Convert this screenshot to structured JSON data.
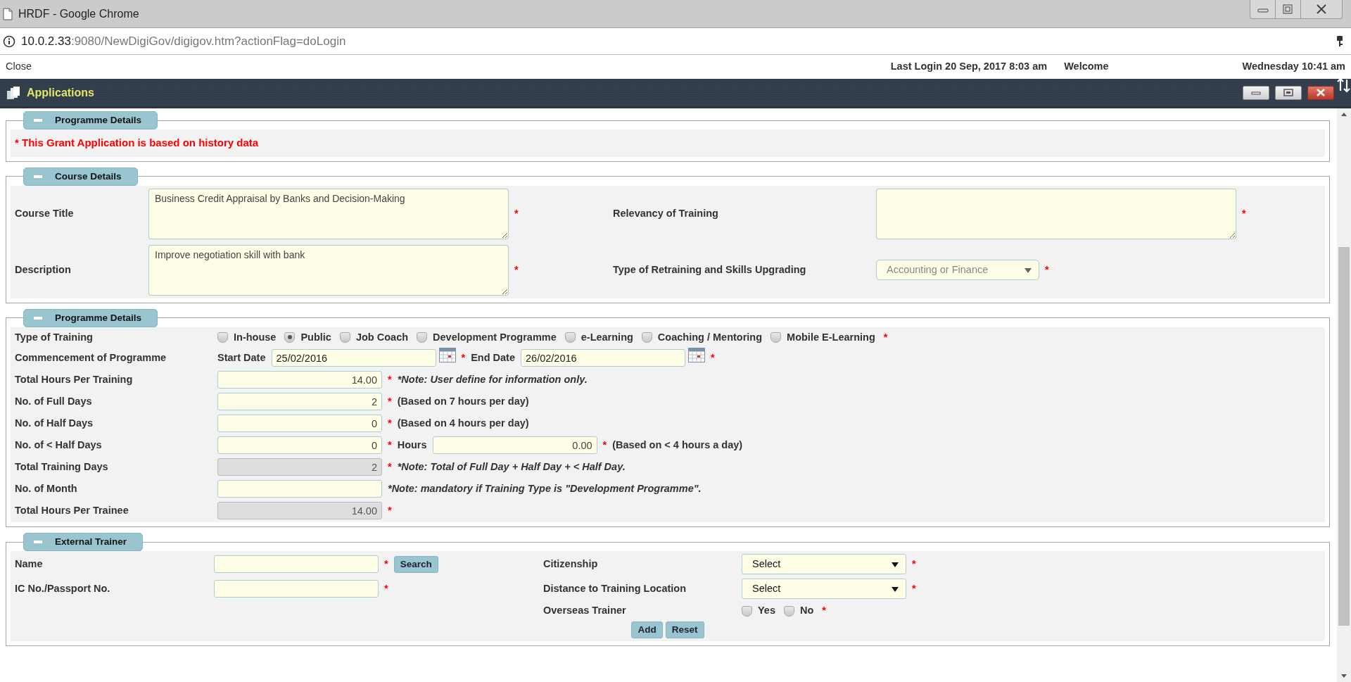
{
  "browser": {
    "title": "HRDF - Google Chrome",
    "url_host": "10.0.2.33",
    "url_rest": ":9080/NewDigiGov/digigov.htm?actionFlag=doLogin"
  },
  "top_bar": {
    "close": "Close",
    "last_login": "Last Login 20 Sep, 2017 8:03 am",
    "welcome": "Welcome",
    "date_time": "Wednesday 10:41 am"
  },
  "app": {
    "title": "Applications"
  },
  "sections": [
    {
      "kind": "notice",
      "legend": "Programme Details",
      "expanded": true,
      "notice": "* This Grant Application is based on history data"
    },
    {
      "kind": "two_column",
      "legend": "Course Details",
      "expanded": true,
      "left": [
        {
          "label": "Course Title",
          "items": [
            {
              "kind": "textarea",
              "value": "Business Credit Appraisal by Banks and Decision-Making"
            },
            {
              "kind": "mark",
              "text": "*"
            }
          ]
        },
        {
          "label": "Description",
          "items": [
            {
              "kind": "textarea",
              "value": "Improve negotiation skill with bank"
            },
            {
              "kind": "mark",
              "text": "*"
            }
          ]
        }
      ],
      "right": [
        {
          "label": "Relevancy of Training",
          "items": [
            {
              "kind": "textarea"
            },
            {
              "kind": "mark",
              "text": "*"
            }
          ]
        },
        {
          "label": "Type of Retraining and  Skills Upgrading",
          "items": [
            {
              "kind": "select",
              "value": "Accounting or Finance",
              "disabled": true
            },
            {
              "kind": "mark",
              "text": "*"
            }
          ]
        }
      ]
    },
    {
      "kind": "single_column",
      "legend": "Programme Details",
      "expanded": true,
      "rows": [
        {
          "label": "Type of Training",
          "items": [
            {
              "kind": "radios",
              "options": [
                {
                  "label": "In-house",
                  "selected": false
                },
                {
                  "label": "Public",
                  "selected": true
                },
                {
                  "label": "Job Coach",
                  "selected": false
                },
                {
                  "label": "Development Programme",
                  "selected": false
                },
                {
                  "label": "e-Learning",
                  "selected": false
                },
                {
                  "label": "Coaching / Mentoring",
                  "selected": false
                },
                {
                  "label": "Mobile E-Learning",
                  "selected": false
                }
              ]
            },
            {
              "kind": "mark",
              "text": "*"
            }
          ]
        },
        {
          "label": "Commencement of Programme",
          "items": [
            {
              "kind": "label",
              "text": "Start Date"
            },
            {
              "kind": "date",
              "value": "25/02/2016"
            },
            {
              "kind": "mark",
              "text": "*"
            },
            {
              "kind": "label",
              "text": "End Date"
            },
            {
              "kind": "date",
              "value": "26/02/2016"
            },
            {
              "kind": "mark",
              "text": "*"
            }
          ]
        },
        {
          "label": "Total Hours Per Training",
          "items": [
            {
              "kind": "input",
              "value": "14.00",
              "disabled": false
            },
            {
              "kind": "mark",
              "text": "*"
            },
            {
              "kind": "note",
              "text": "*Note: User define for information only."
            }
          ]
        },
        {
          "label": "No. of Full Days",
          "items": [
            {
              "kind": "input",
              "value": "2",
              "disabled": false
            },
            {
              "kind": "mark",
              "text": "*"
            },
            {
              "kind": "hint",
              "text": "(Based on 7 hours per day)"
            }
          ]
        },
        {
          "label": "No. of Half Days",
          "items": [
            {
              "kind": "input",
              "value": "0",
              "disabled": false
            },
            {
              "kind": "mark",
              "text": "*"
            },
            {
              "kind": "hint",
              "text": "(Based on 4 hours per day)"
            }
          ]
        },
        {
          "label": "No. of < Half Days",
          "items": [
            {
              "kind": "input",
              "value": "0",
              "disabled": false
            },
            {
              "kind": "mark",
              "text": "*"
            },
            {
              "kind": "label",
              "text": "Hours"
            },
            {
              "kind": "input",
              "value": "0.00",
              "disabled": false
            },
            {
              "kind": "mark",
              "text": "*"
            },
            {
              "kind": "hint",
              "text": "(Based on < 4 hours a day)"
            }
          ]
        },
        {
          "label": "Total Training Days",
          "items": [
            {
              "kind": "input",
              "value": "2",
              "disabled": true
            },
            {
              "kind": "mark",
              "text": "*"
            },
            {
              "kind": "note",
              "text": "*Note: Total of Full Day + Half Day + < Half Day."
            }
          ]
        },
        {
          "label": "No. of Month",
          "items": [
            {
              "kind": "input",
              "disabled": false
            },
            {
              "kind": "note",
              "text": "*Note: mandatory if Training Type is \"Development Programme\"."
            }
          ]
        },
        {
          "label": "Total Hours Per Trainee",
          "items": [
            {
              "kind": "input",
              "value": "14.00",
              "disabled": true
            },
            {
              "kind": "mark",
              "text": "*"
            }
          ]
        }
      ]
    },
    {
      "kind": "two_column",
      "legend": "External Trainer",
      "expanded": true,
      "left": [
        {
          "label": "Name",
          "items": [
            {
              "kind": "input",
              "disabled": false
            },
            {
              "kind": "mark",
              "text": "*"
            },
            {
              "kind": "button",
              "text": "Search"
            }
          ]
        },
        {
          "label": "IC No./Passport No.",
          "items": [
            {
              "kind": "input",
              "disabled": false
            },
            {
              "kind": "mark",
              "text": "*"
            }
          ]
        }
      ],
      "right": [
        {
          "label": "Citizenship",
          "items": [
            {
              "kind": "select",
              "value": "Select",
              "disabled": false
            },
            {
              "kind": "mark",
              "text": "*"
            }
          ]
        },
        {
          "label": "Distance to Training Location",
          "items": [
            {
              "kind": "select",
              "value": "Select",
              "disabled": false
            },
            {
              "kind": "mark",
              "text": "*"
            }
          ]
        },
        {
          "label": "Overseas Trainer",
          "items": [
            {
              "kind": "radios",
              "options": [
                {
                  "label": "Yes",
                  "selected": false
                },
                {
                  "label": "No",
                  "selected": false
                }
              ]
            },
            {
              "kind": "mark",
              "text": "*"
            }
          ]
        }
      ],
      "buttons": [
        "Add",
        "Reset"
      ]
    }
  ]
}
